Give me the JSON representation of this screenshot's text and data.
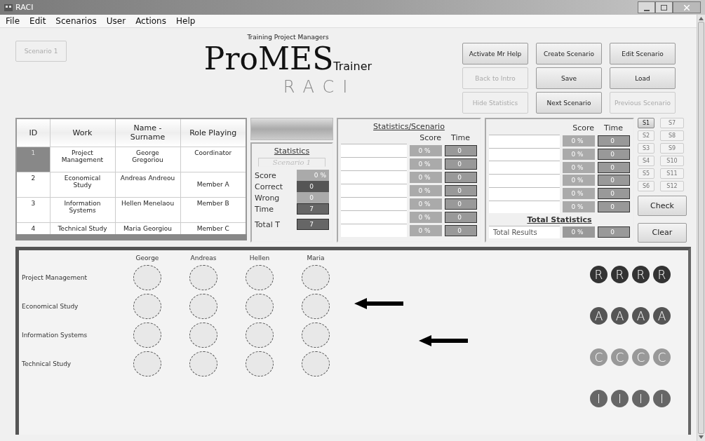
{
  "window": {
    "title": "RACI"
  },
  "menu": [
    "File",
    "Edit",
    "Scenarios",
    "User",
    "Actions",
    "Help"
  ],
  "scenario_button": {
    "label": "Scenario 1",
    "disabled": true
  },
  "logo": {
    "tagline": "Training Project Managers",
    "name": "ProMES",
    "suffix": "Trainer",
    "subtitle": "RACI"
  },
  "actions": [
    {
      "label": "Activate Mr Help",
      "disabled": false
    },
    {
      "label": "Create Scenario",
      "disabled": false
    },
    {
      "label": "Edit Scenario",
      "disabled": false
    },
    {
      "label": "Back to Intro",
      "disabled": true
    },
    {
      "label": "Save",
      "disabled": false
    },
    {
      "label": "Load",
      "disabled": false
    },
    {
      "label": "Hide Statistics",
      "disabled": true
    },
    {
      "label": "Next Scenario",
      "disabled": false
    },
    {
      "label": "Previous Scenario",
      "disabled": true
    }
  ],
  "team_table": {
    "columns": [
      "ID",
      "Work",
      "Name - Surname",
      "Role Playing"
    ],
    "rows": [
      {
        "id": "1",
        "work": "Project Management",
        "name": "George Gregoriou",
        "role": "Coordinator",
        "selected": true
      },
      {
        "id": "2",
        "work": "Economical Study",
        "name": "Andreas Andreou",
        "role": "Member A",
        "selected": false
      },
      {
        "id": "3",
        "work": "Information Systems",
        "name": "Hellen Menelaou",
        "role": "Member B",
        "selected": false
      },
      {
        "id": "4",
        "work": "Technical Study",
        "name": "Maria Georgiou",
        "role": "Member C",
        "selected": false
      }
    ]
  },
  "statistics": {
    "title": "Statistics",
    "scenario": "Scenario 1",
    "items": [
      {
        "label": "Score",
        "value": "0 %",
        "kind": "score"
      },
      {
        "label": "Correct",
        "value": "0",
        "kind": "correct"
      },
      {
        "label": "Wrong",
        "value": "0",
        "kind": "wrong"
      },
      {
        "label": "Time",
        "value": "7",
        "kind": "time"
      },
      {
        "label": "Total T",
        "value": "7",
        "kind": "total"
      }
    ]
  },
  "scenario_statistics": {
    "title": "Statistics/Scenario",
    "score_header": "Score",
    "time_header": "Time",
    "rows": [
      {
        "score": "0 %",
        "time": "0"
      },
      {
        "score": "0 %",
        "time": "0"
      },
      {
        "score": "0 %",
        "time": "0"
      },
      {
        "score": "0 %",
        "time": "0"
      },
      {
        "score": "0 %",
        "time": "0"
      },
      {
        "score": "0 %",
        "time": "0"
      },
      {
        "score": "0 %",
        "time": "0"
      }
    ]
  },
  "total_statistics": {
    "score_header": "Score",
    "time_header": "Time",
    "rows": [
      {
        "score": "0 %",
        "time": "0"
      },
      {
        "score": "0 %",
        "time": "0"
      },
      {
        "score": "0 %",
        "time": "0"
      },
      {
        "score": "0 %",
        "time": "0"
      },
      {
        "score": "0 %",
        "time": "0"
      },
      {
        "score": "0 %",
        "time": "0"
      }
    ],
    "title": "Total Statistics",
    "total": {
      "label": "Total Results",
      "score": "0 %",
      "time": "0"
    }
  },
  "scenario_slots": [
    {
      "label": "S1",
      "selected": true,
      "disabled": false
    },
    {
      "label": "S2",
      "selected": false,
      "disabled": true
    },
    {
      "label": "S3",
      "selected": false,
      "disabled": true
    },
    {
      "label": "S4",
      "selected": false,
      "disabled": true
    },
    {
      "label": "S5",
      "selected": false,
      "disabled": true
    },
    {
      "label": "S6",
      "selected": false,
      "disabled": true
    },
    {
      "label": "S7",
      "selected": false,
      "disabled": true
    },
    {
      "label": "S8",
      "selected": false,
      "disabled": true
    },
    {
      "label": "S9",
      "selected": false,
      "disabled": true
    },
    {
      "label": "S10",
      "selected": false,
      "disabled": true
    },
    {
      "label": "S11",
      "selected": false,
      "disabled": true
    },
    {
      "label": "S12",
      "selected": false,
      "disabled": true
    }
  ],
  "side_buttons": [
    "Check",
    "Clear"
  ],
  "board": {
    "people": [
      "George",
      "Andreas",
      "Hellen",
      "Maria"
    ],
    "tasks": [
      "Project Management",
      "Economical Study",
      "Information Systems",
      "Technical Study"
    ],
    "role_tokens": [
      {
        "color": "#333333",
        "tokens": [
          "R",
          "R",
          "R",
          "R"
        ]
      },
      {
        "color": "#555555",
        "tokens": [
          "A",
          "A",
          "A",
          "A"
        ]
      },
      {
        "color": "#999999",
        "tokens": [
          "C",
          "C",
          "C",
          "C"
        ]
      },
      {
        "color": "#666666",
        "tokens": [
          "I",
          "I",
          "I",
          "I"
        ]
      }
    ]
  }
}
